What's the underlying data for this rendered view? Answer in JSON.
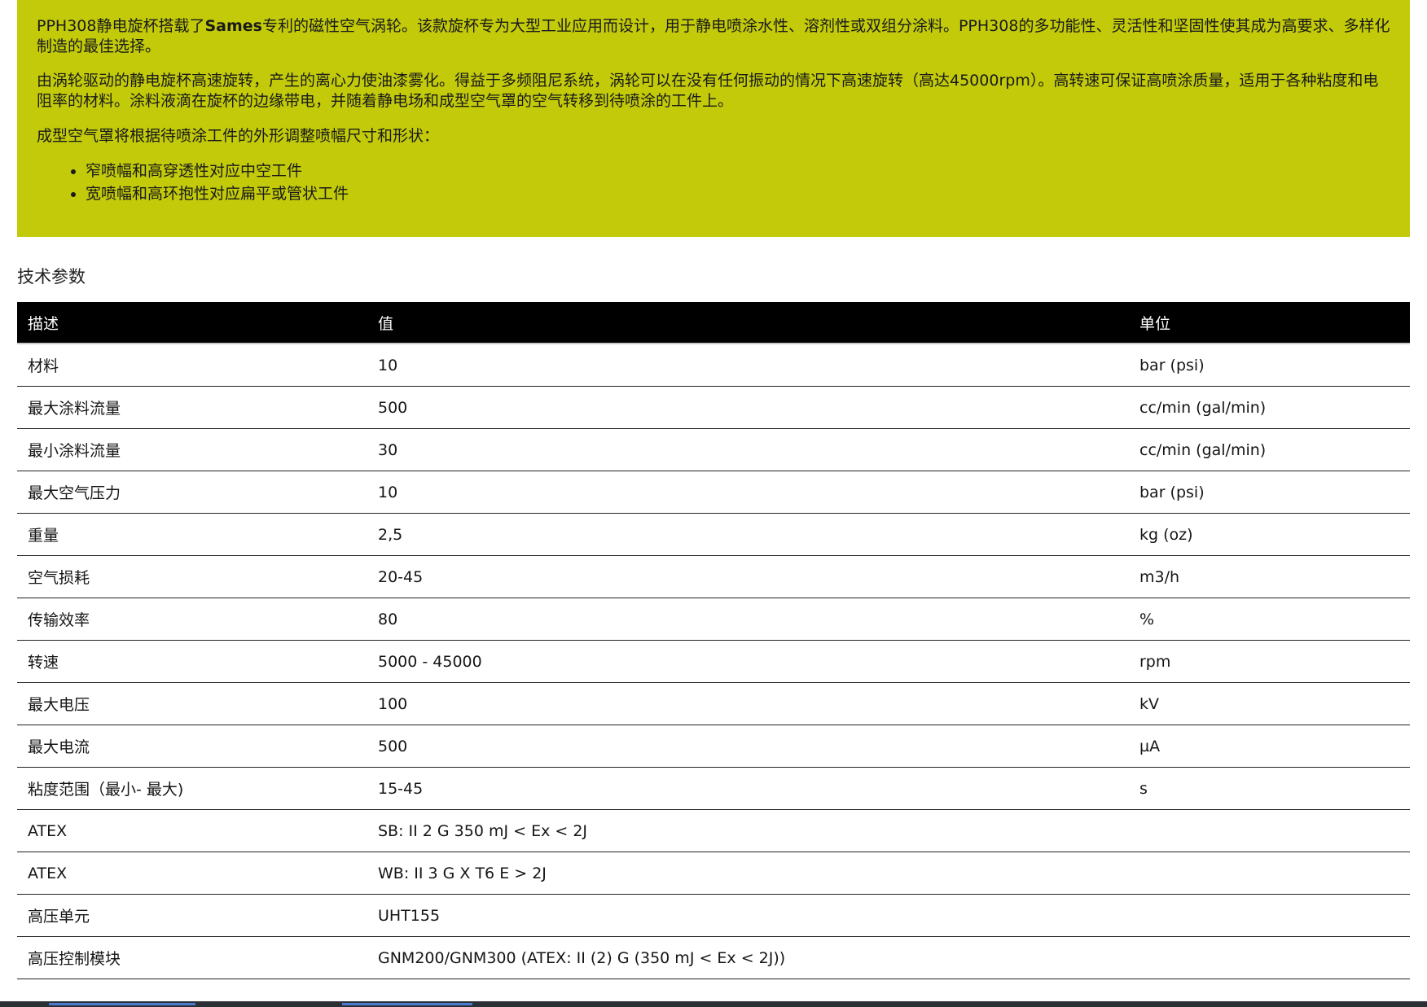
{
  "intro": {
    "p1_prefix": "PPH308静电旋杯搭载了",
    "p1_brand": "Sames",
    "p1_suffix": "专利的磁性空气涡轮。该款旋杯专为大型工业应用而设计，用于静电喷涂水性、溶剂性或双组分涂料。PPH308的多功能性、灵活性和坚固性使其成为高要求、多样化制造的最佳选择。",
    "p2": "由涡轮驱动的静电旋杯高速旋转，产生的离心力使油漆雾化。得益于多频阻尼系统，涡轮可以在没有任何振动的情况下高速旋转（高达45000rpm）。高转速可保证高喷涂质量，适用于各种粘度和电阻率的材料。涂料液滴在旋杯的边缘带电，并随着静电场和成型空气罩的空气转移到待喷涂的工件上。",
    "p3": "成型空气罩将根据待喷涂工件的外形调整喷幅尺寸和形状：",
    "bullets": [
      "窄喷幅和高穿透性对应中空工件",
      "宽喷幅和高环抱性对应扁平或管状工件"
    ]
  },
  "section_title": "技术参数",
  "table": {
    "headers": [
      "描述",
      "值",
      "单位"
    ],
    "rows": [
      [
        "材料",
        "10",
        "bar (psi)"
      ],
      [
        "最大涂料流量",
        "500",
        "cc/min (gal/min)"
      ],
      [
        "最小涂料流量",
        "30",
        "cc/min (gal/min)"
      ],
      [
        "最大空气压力",
        "10",
        "bar (psi)"
      ],
      [
        "重量",
        "2,5",
        "kg (oz)"
      ],
      [
        "空气损耗",
        "20-45",
        "m3/h"
      ],
      [
        "传输效率",
        "80",
        "%"
      ],
      [
        "转速",
        "5000 - 45000",
        "rpm"
      ],
      [
        "最大电压",
        "100",
        "kV"
      ],
      [
        "最大电流",
        "500",
        "µA"
      ],
      [
        "粘度范围（最小- 最大)",
        "15-45",
        "s"
      ],
      [
        "ATEX",
        "SB: II 2 G 350 mJ < Ex < 2J",
        ""
      ],
      [
        "ATEX",
        "WB: II 3 G X T6 E > 2J",
        ""
      ],
      [
        "高压单元",
        "UHT155",
        ""
      ],
      [
        "高压控制模块",
        "GNM200/GNM300 (ATEX: II (2) G (350 mJ < Ex < 2J))",
        ""
      ]
    ]
  },
  "colors": {
    "intro_background": "#c2ca0a",
    "table_header_background": "#000000",
    "table_header_text": "#ffffff"
  }
}
